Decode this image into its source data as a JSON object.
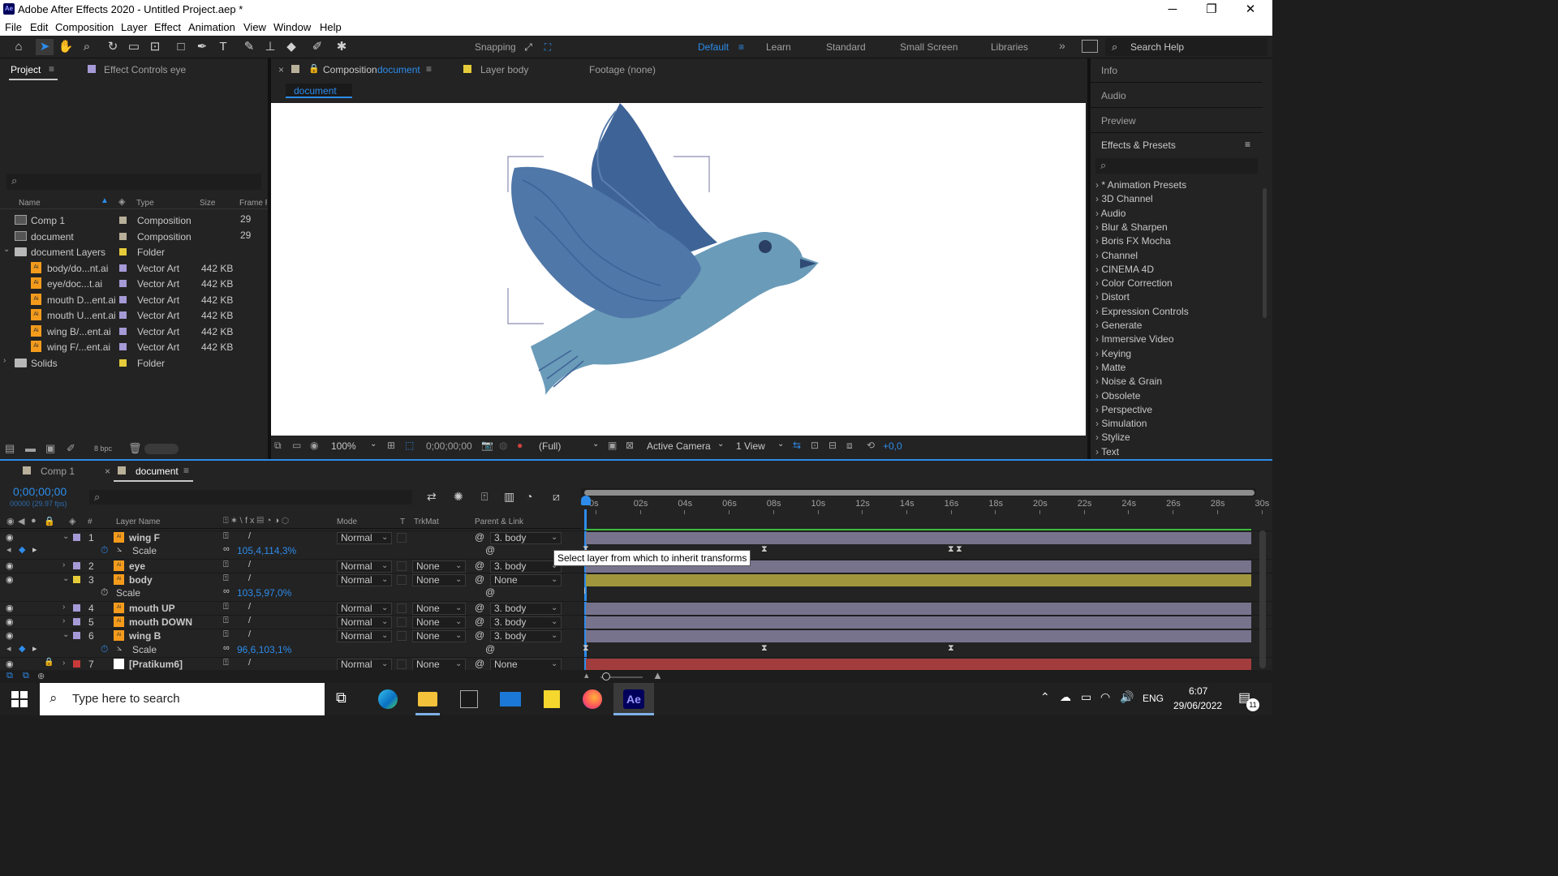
{
  "titlebar": {
    "title": "Adobe After Effects 2020 - Untitled Project.aep *",
    "logo": "Ae",
    "min": "─",
    "max": "❐",
    "close": "✕"
  },
  "menu": [
    "File",
    "Edit",
    "Composition",
    "Layer",
    "Effect",
    "Animation",
    "View",
    "Window",
    "Help"
  ],
  "toolbar": {
    "snapping": "Snapping"
  },
  "workspaces": {
    "default": "Default",
    "learn": "Learn",
    "standard": "Standard",
    "small_screen": "Small Screen",
    "libraries": "Libraries",
    "more": "»",
    "search_placeholder": "Search Help"
  },
  "project_panel": {
    "tab_project": "Project",
    "tab_effect_controls": "Effect Controls eye",
    "columns": {
      "name": "Name",
      "type": "Type",
      "size": "Size",
      "frame": "Frame R"
    },
    "items": [
      {
        "name": "Comp 1",
        "type": "Composition",
        "size": "",
        "frame": "29",
        "color": "#b9b09a",
        "indent": 0,
        "kind": "comp"
      },
      {
        "name": "document",
        "type": "Composition",
        "size": "",
        "frame": "29",
        "color": "#b9b09a",
        "indent": 0,
        "kind": "comp"
      },
      {
        "name": "document Layers",
        "type": "Folder",
        "size": "",
        "frame": "",
        "color": "#e6cb3a",
        "indent": 0,
        "kind": "folder"
      },
      {
        "name": "body/do...nt.ai",
        "type": "Vector Art",
        "size": "442 KB",
        "frame": "",
        "color": "#a59ad6",
        "indent": 1,
        "kind": "ai"
      },
      {
        "name": "eye/doc...t.ai",
        "type": "Vector Art",
        "size": "442 KB",
        "frame": "",
        "color": "#a59ad6",
        "indent": 1,
        "kind": "ai"
      },
      {
        "name": "mouth D...ent.ai",
        "type": "Vector Art",
        "size": "442 KB",
        "frame": "",
        "color": "#a59ad6",
        "indent": 1,
        "kind": "ai"
      },
      {
        "name": "mouth U...ent.ai",
        "type": "Vector Art",
        "size": "442 KB",
        "frame": "",
        "color": "#a59ad6",
        "indent": 1,
        "kind": "ai"
      },
      {
        "name": "wing B/...ent.ai",
        "type": "Vector Art",
        "size": "442 KB",
        "frame": "",
        "color": "#a59ad6",
        "indent": 1,
        "kind": "ai"
      },
      {
        "name": "wing F/...ent.ai",
        "type": "Vector Art",
        "size": "442 KB",
        "frame": "",
        "color": "#a59ad6",
        "indent": 1,
        "kind": "ai"
      },
      {
        "name": "Solids",
        "type": "Folder",
        "size": "",
        "frame": "",
        "color": "#e6cb3a",
        "indent": 0,
        "kind": "folder"
      }
    ],
    "bpc": "8 bpc"
  },
  "comp_panel": {
    "tab_composition": "Composition",
    "tab_composition_name": "document",
    "tab_layer": "Layer  body",
    "tab_footage": "Footage  (none)",
    "breadcrumb": "document",
    "zoom": "100%",
    "timecode": "0;00;00;00",
    "resolution": "(Full)",
    "camera": "Active Camera",
    "view": "1 View",
    "exposure": "+0,0"
  },
  "right_panel": {
    "info": "Info",
    "audio": "Audio",
    "preview": "Preview",
    "effects_presets": "Effects & Presets",
    "effects": [
      "* Animation Presets",
      "3D Channel",
      "Audio",
      "Blur & Sharpen",
      "Boris FX Mocha",
      "Channel",
      "CINEMA 4D",
      "Color Correction",
      "Distort",
      "Expression Controls",
      "Generate",
      "Immersive Video",
      "Keying",
      "Matte",
      "Noise & Grain",
      "Obsolete",
      "Perspective",
      "Simulation",
      "Stylize",
      "Text"
    ]
  },
  "timeline": {
    "tab_comp1": "Comp 1",
    "tab_document": "document",
    "timecode": "0;00;00;00",
    "fps": "00000 (29.97 fps)",
    "columns": {
      "num": "#",
      "layer_name": "Layer Name",
      "mode": "Mode",
      "t": "T",
      "trkmat": "TrkMat",
      "parent": "Parent & Link"
    },
    "ruler": [
      "0s",
      "02s",
      "04s",
      "06s",
      "08s",
      "10s",
      "12s",
      "14s",
      "16s",
      "18s",
      "20s",
      "22s",
      "24s",
      "26s",
      "28s",
      "30s"
    ],
    "tooltip": "Select layer from which to inherit transforms",
    "rows": [
      {
        "kind": "layer",
        "num": "1",
        "name": "wing F",
        "mode": "Normal",
        "trkmat": "",
        "parent": "3. body",
        "color": "#a59ad6",
        "bar": "#77738d",
        "expanded": true
      },
      {
        "kind": "prop",
        "name": "Scale",
        "value": "105,4,114,3%",
        "keyframes": true
      },
      {
        "kind": "layer",
        "num": "2",
        "name": "eye",
        "mode": "Normal",
        "trkmat": "None",
        "parent": "3. body",
        "color": "#a59ad6",
        "bar": "#77738d",
        "expanded": false
      },
      {
        "kind": "layer",
        "num": "3",
        "name": "body",
        "mode": "Normal",
        "trkmat": "None",
        "parent": "None",
        "color": "#e6cb3a",
        "bar": "#9f963e",
        "expanded": true
      },
      {
        "kind": "prop",
        "name": "Scale",
        "value": "103,5,97,0%",
        "keyframes": false
      },
      {
        "kind": "layer",
        "num": "4",
        "name": "mouth UP",
        "mode": "Normal",
        "trkmat": "None",
        "parent": "3. body",
        "color": "#a59ad6",
        "bar": "#77738d",
        "expanded": false
      },
      {
        "kind": "layer",
        "num": "5",
        "name": "mouth DOWN",
        "mode": "Normal",
        "trkmat": "None",
        "parent": "3. body",
        "color": "#a59ad6",
        "bar": "#77738d",
        "expanded": false
      },
      {
        "kind": "layer",
        "num": "6",
        "name": "wing B",
        "mode": "Normal",
        "trkmat": "None",
        "parent": "3. body",
        "color": "#a59ad6",
        "bar": "#77738d",
        "expanded": true
      },
      {
        "kind": "prop",
        "name": "Scale",
        "value": "96,6,103,1%",
        "keyframes": true
      },
      {
        "kind": "layer",
        "num": "7",
        "name": "[Pratikum6]",
        "mode": "Normal",
        "trkmat": "None",
        "parent": "None",
        "color": "#c93a3a",
        "bar": "#a33d3d",
        "expanded": false
      }
    ]
  },
  "taskbar": {
    "search_placeholder": "Type here to search",
    "lang": "ENG",
    "time": "6:07",
    "date": "29/06/2022",
    "notif_count": "11",
    "ae": "Ae"
  },
  "colors": {
    "accent": "#2d8ceb",
    "bird_light": "#6a9bb9",
    "bird_dark": "#3e6397",
    "bird_mid": "#4f77a8"
  }
}
